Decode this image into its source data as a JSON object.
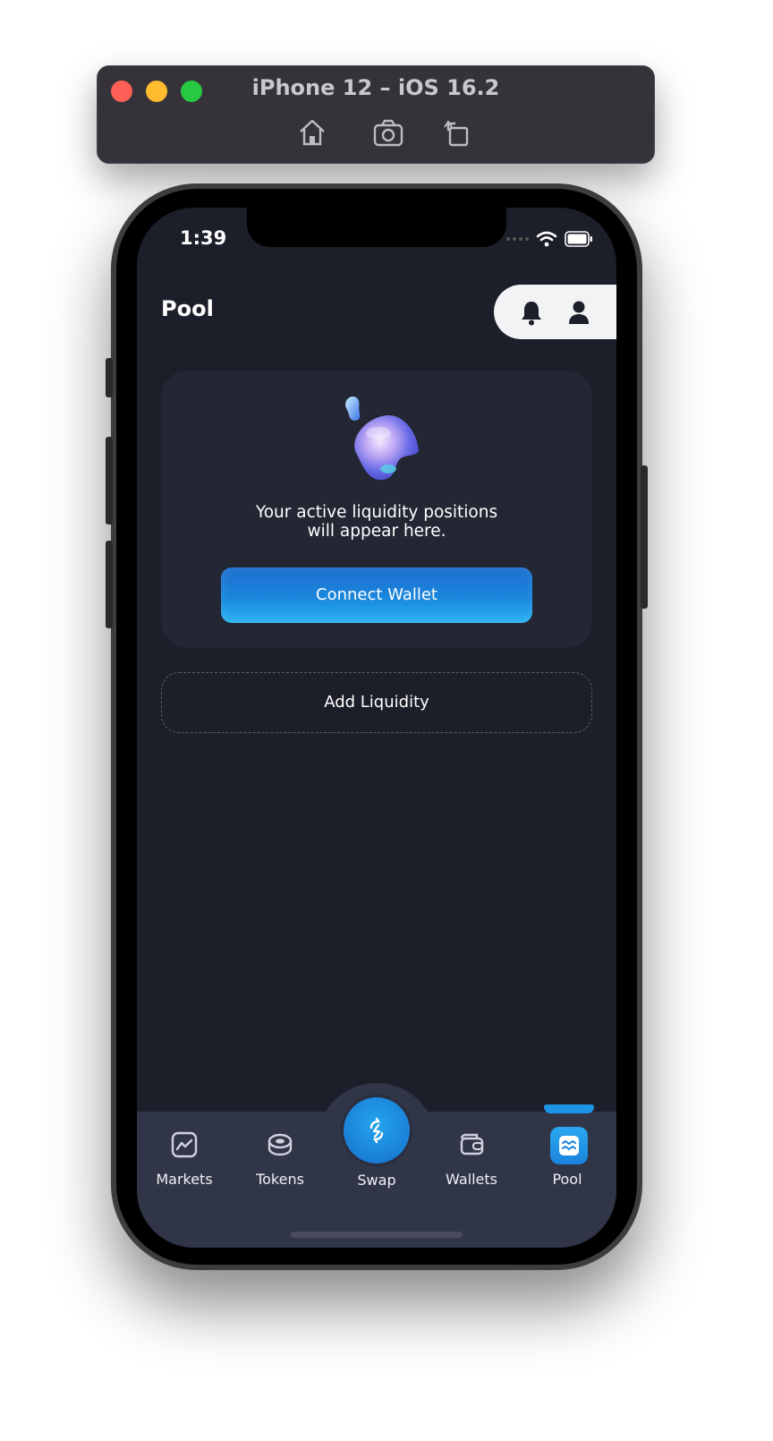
{
  "simulator": {
    "title": "iPhone 12 – iOS 16.2",
    "tools": [
      "home-icon",
      "screenshot-icon",
      "rotate-icon"
    ]
  },
  "status_bar": {
    "time": "1:39"
  },
  "header": {
    "title": "Pool",
    "icons": [
      "bell-icon",
      "user-icon"
    ]
  },
  "empty_state": {
    "line1": "Your active liquidity positions",
    "line2": "will appear here.",
    "button": "Connect Wallet"
  },
  "add_liquidity": {
    "label": "Add Liquidity"
  },
  "tabs": [
    {
      "label": "Markets",
      "icon": "chart-icon"
    },
    {
      "label": "Tokens",
      "icon": "coins-icon"
    },
    {
      "label": "Swap",
      "icon": "swap-icon"
    },
    {
      "label": "Wallets",
      "icon": "wallet-icon"
    },
    {
      "label": "Pool",
      "icon": "pool-icon",
      "active": true
    }
  ],
  "colors": {
    "background": "#1c1e29",
    "card": "#232633",
    "accent": "#1a86dc",
    "tabbar": "#313548"
  }
}
